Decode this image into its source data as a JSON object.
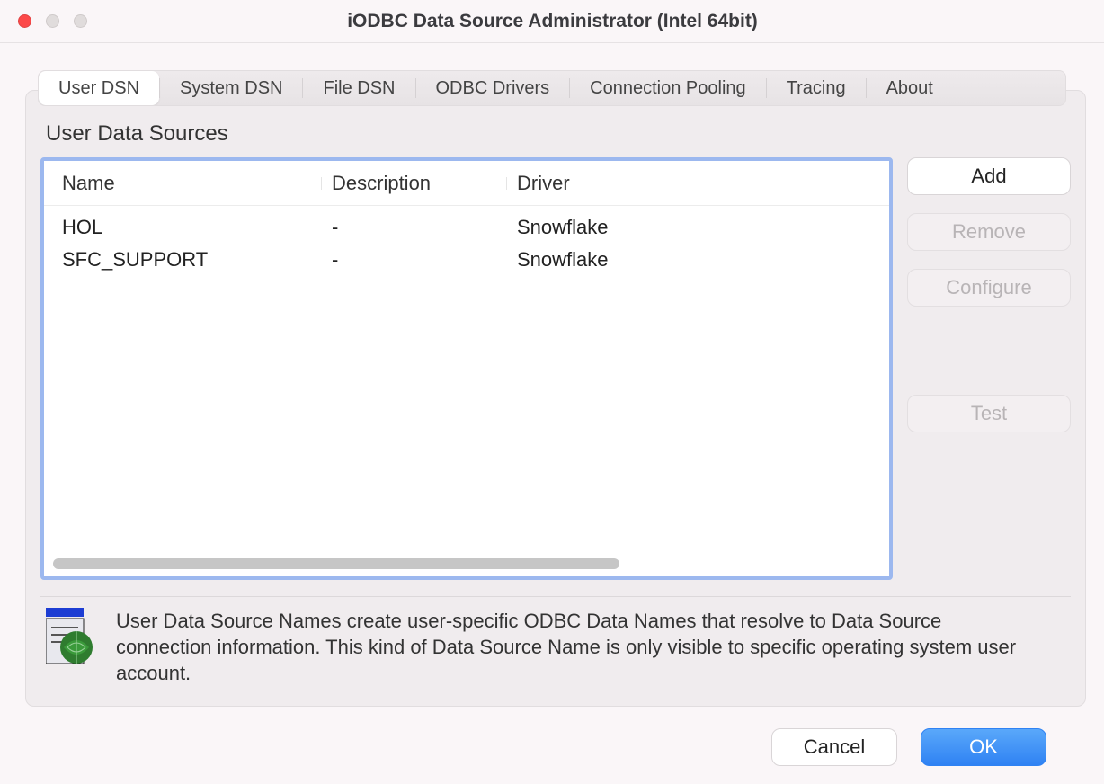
{
  "window": {
    "title": "iODBC Data Source Administrator (Intel 64bit)"
  },
  "tabs": [
    {
      "label": "User DSN",
      "active": true
    },
    {
      "label": "System DSN",
      "active": false
    },
    {
      "label": "File DSN",
      "active": false
    },
    {
      "label": "ODBC Drivers",
      "active": false
    },
    {
      "label": "Connection Pooling",
      "active": false
    },
    {
      "label": "Tracing",
      "active": false
    },
    {
      "label": "About",
      "active": false
    }
  ],
  "panel": {
    "title": "User Data Sources",
    "columns": {
      "name": "Name",
      "description": "Description",
      "driver": "Driver"
    },
    "rows": [
      {
        "name": "HOL",
        "description": "-",
        "driver": "Snowflake"
      },
      {
        "name": "SFC_SUPPORT",
        "description": "-",
        "driver": "Snowflake"
      }
    ],
    "buttons": {
      "add": "Add",
      "remove": "Remove",
      "configure": "Configure",
      "test": "Test"
    },
    "description": "User Data Source Names create user-specific ODBC Data Names that resolve to Data Source connection information. This kind of Data Source Name is only visible to specific operating system user account."
  },
  "footer": {
    "cancel": "Cancel",
    "ok": "OK"
  }
}
